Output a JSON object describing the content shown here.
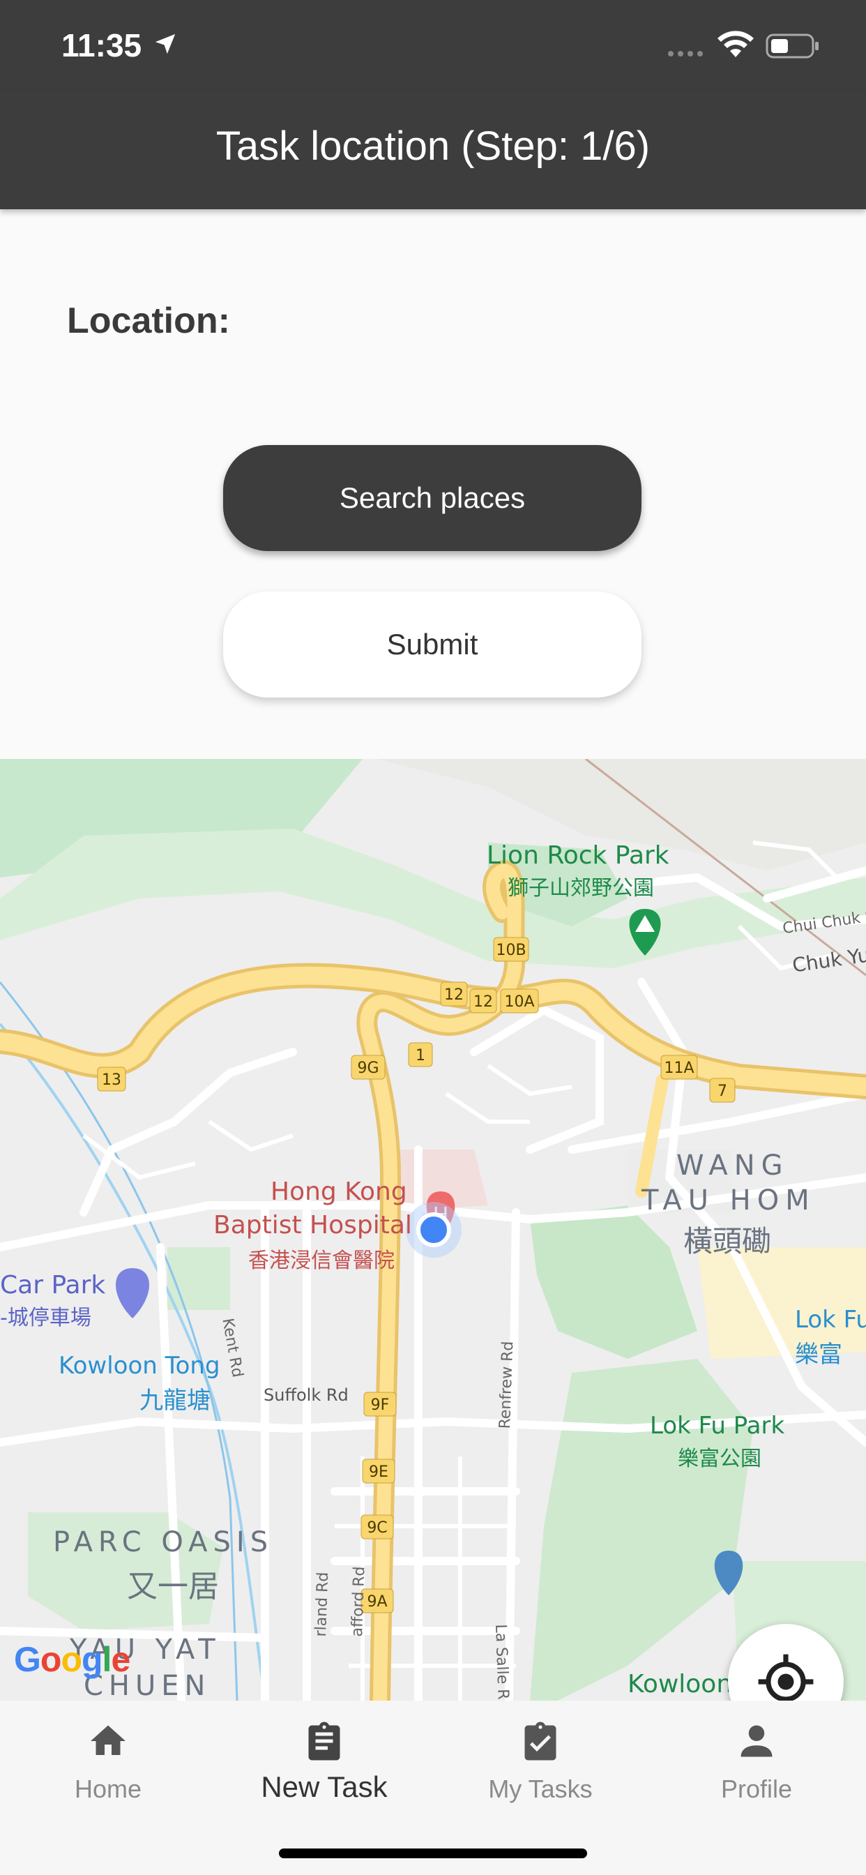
{
  "status": {
    "time": "11:35"
  },
  "header": {
    "title": "Task location (Step: 1/6)"
  },
  "form": {
    "location_label": "Location:",
    "search_label": "Search places",
    "submit_label": "Submit"
  },
  "map": {
    "labels": {
      "lion_rock_en": "Lion Rock Park",
      "lion_rock_zh": "獅子山郊野公園",
      "chui_chuk": "Chui Chuk S",
      "chuk_yuen": "Chuk Yu",
      "wang_tau_hom_en_1": "WANG",
      "wang_tau_hom_en_2": "TAU HOM",
      "wang_tau_hom_zh": "橫頭磡",
      "hospital_en_1": "Hong Kong",
      "hospital_en_2": "Baptist Hospital",
      "hospital_zh": "香港浸信會醫院",
      "car_park_en": "Car Park",
      "car_park_zh": "-城停車場",
      "kowloon_tong_en": "Kowloon Tong",
      "kowloon_tong_zh": "九龍塘",
      "kent_rd": "Kent Rd",
      "suffolk_rd": "Suffolk Rd",
      "renfrew_rd": "Renfrew Rd",
      "lok_fu_en": "Lok Fu",
      "lok_fu_zh": "樂富",
      "lok_fu_park_en": "Lok Fu Park",
      "lok_fu_park_zh": "樂富公園",
      "parc_oasis_en": "PARC OASIS",
      "parc_oasis_zh": "又一居",
      "yau_yat_1": "YAU YAT",
      "yau_yat_2": "CHUEN",
      "kowloon": "Kowloon",
      "la_salle_rd": "La Salle R",
      "oxford_rd": "rland Rd",
      "stafford_rd": "afford Rd"
    },
    "route_shields": [
      "10B",
      "12",
      "12",
      "10A",
      "1",
      "9G",
      "13",
      "11A",
      "7",
      "9F",
      "9E",
      "9C",
      "9A"
    ],
    "attribution": "Google"
  },
  "tabs": [
    {
      "label": "Home",
      "icon": "home-icon"
    },
    {
      "label": "New Task",
      "icon": "clipboard-icon"
    },
    {
      "label": "My Tasks",
      "icon": "clipboard-check-icon"
    },
    {
      "label": "Profile",
      "icon": "person-icon"
    }
  ]
}
